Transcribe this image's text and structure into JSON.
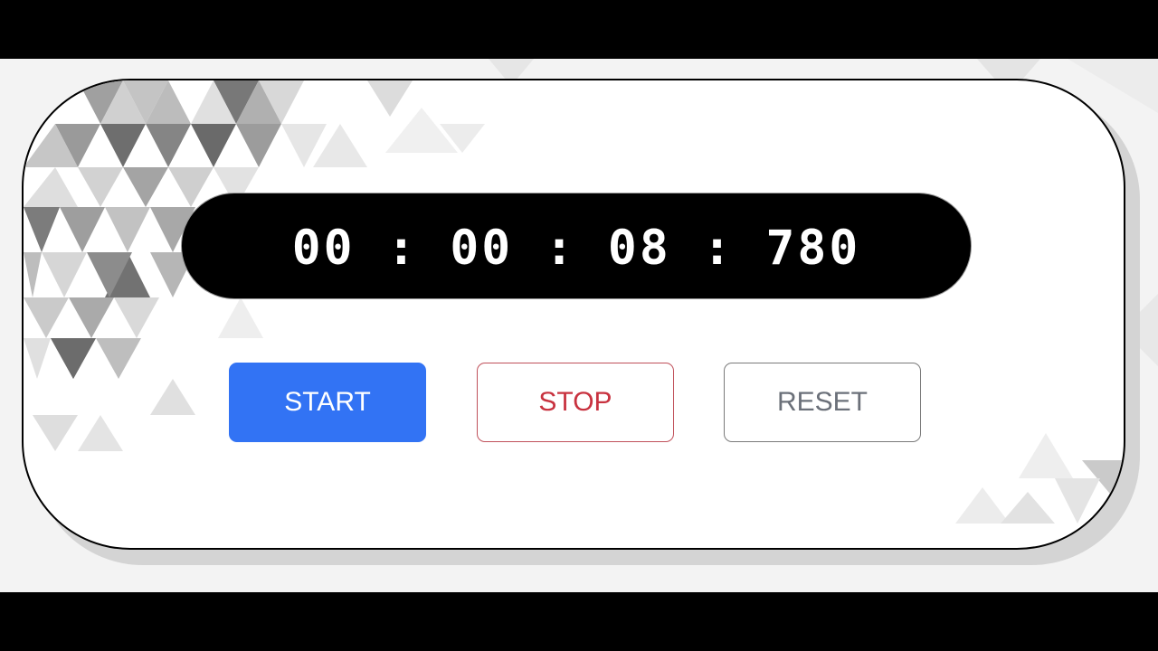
{
  "timer": {
    "hours": "00",
    "minutes": "00",
    "seconds": "08",
    "milliseconds": "780",
    "separator": ":"
  },
  "controls": {
    "start_label": "START",
    "stop_label": "STOP",
    "reset_label": "RESET"
  },
  "colors": {
    "start_button": "#3273f4",
    "stop_text": "#c8323f",
    "reset_text": "#6b7079",
    "display_background": "#000000",
    "display_text": "#ffffff"
  }
}
